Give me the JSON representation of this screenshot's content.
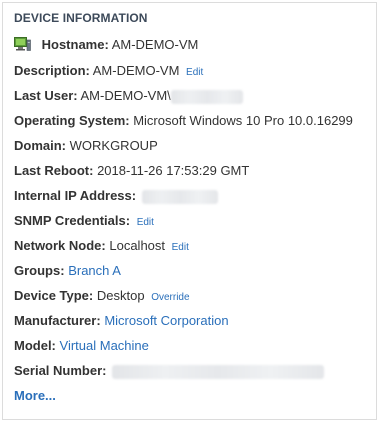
{
  "panel": {
    "title": "DEVICE INFORMATION"
  },
  "fields": {
    "hostname": {
      "label": "Hostname:",
      "value": "AM-DEMO-VM",
      "icon": "computer-icon"
    },
    "description": {
      "label": "Description:",
      "value": "AM-DEMO-VM",
      "action": "Edit"
    },
    "last_user": {
      "label": "Last User:",
      "value": "AM-DEMO-VM\\"
    },
    "operating_system": {
      "label": "Operating System:",
      "value": "Microsoft Windows 10 Pro 10.0.16299"
    },
    "domain": {
      "label": "Domain:",
      "value": "WORKGROUP"
    },
    "last_reboot": {
      "label": "Last Reboot:",
      "value": "2018-11-26 17:53:29 GMT"
    },
    "internal_ip": {
      "label": "Internal IP Address:"
    },
    "snmp_credentials": {
      "label": "SNMP Credentials:",
      "action": "Edit"
    },
    "network_node": {
      "label": "Network Node:",
      "value": "Localhost",
      "action": "Edit"
    },
    "groups": {
      "label": "Groups:",
      "value": "Branch A"
    },
    "device_type": {
      "label": "Device Type:",
      "value": "Desktop",
      "action": "Override"
    },
    "manufacturer": {
      "label": "Manufacturer:",
      "value": "Microsoft Corporation"
    },
    "model": {
      "label": "Model:",
      "value": "Virtual Machine"
    },
    "serial_number": {
      "label": "Serial Number:"
    }
  },
  "more_link": "More...",
  "colors": {
    "link": "#2a6fba",
    "title": "#3d4a5a",
    "border": "#dcdcdc"
  }
}
